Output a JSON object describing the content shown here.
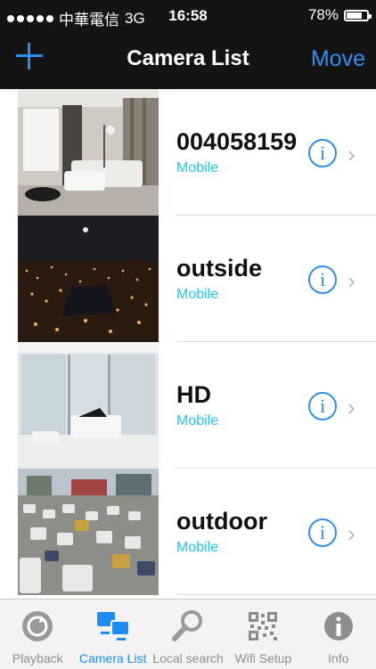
{
  "status_bar": {
    "carrier": "中華電信",
    "network": "3G",
    "time": "16:58",
    "battery_text": "78%",
    "battery_level": 0.78
  },
  "navbar": {
    "add_icon": "plus-icon",
    "title": "Camera List",
    "move_label": "Move"
  },
  "cameras": [
    {
      "name": "004058159",
      "type": "Mobile",
      "thumbnail": "living-room-image"
    },
    {
      "name": "outside",
      "type": "Mobile",
      "thumbnail": "night-city-image"
    },
    {
      "name": "HD",
      "type": "Mobile",
      "thumbnail": "white-room-image"
    },
    {
      "name": "outdoor",
      "type": "Mobile",
      "thumbnail": "traffic-image"
    }
  ],
  "row_icons": {
    "info": "info-icon",
    "chevron": "chevron-right-icon"
  },
  "tabs": [
    {
      "label": "Playback",
      "icon": "playback-icon",
      "active": false
    },
    {
      "label": "Camera List",
      "icon": "camera-list-icon",
      "active": true
    },
    {
      "label": "Local search",
      "icon": "search-icon",
      "active": false
    },
    {
      "label": "Wifi Setup",
      "icon": "qr-code-icon",
      "active": false
    },
    {
      "label": "Info",
      "icon": "info-icon",
      "active": false
    }
  ],
  "colors": {
    "accent": "#2f8ff0",
    "subtitle": "#1ec7f0",
    "bar": "#141414"
  }
}
